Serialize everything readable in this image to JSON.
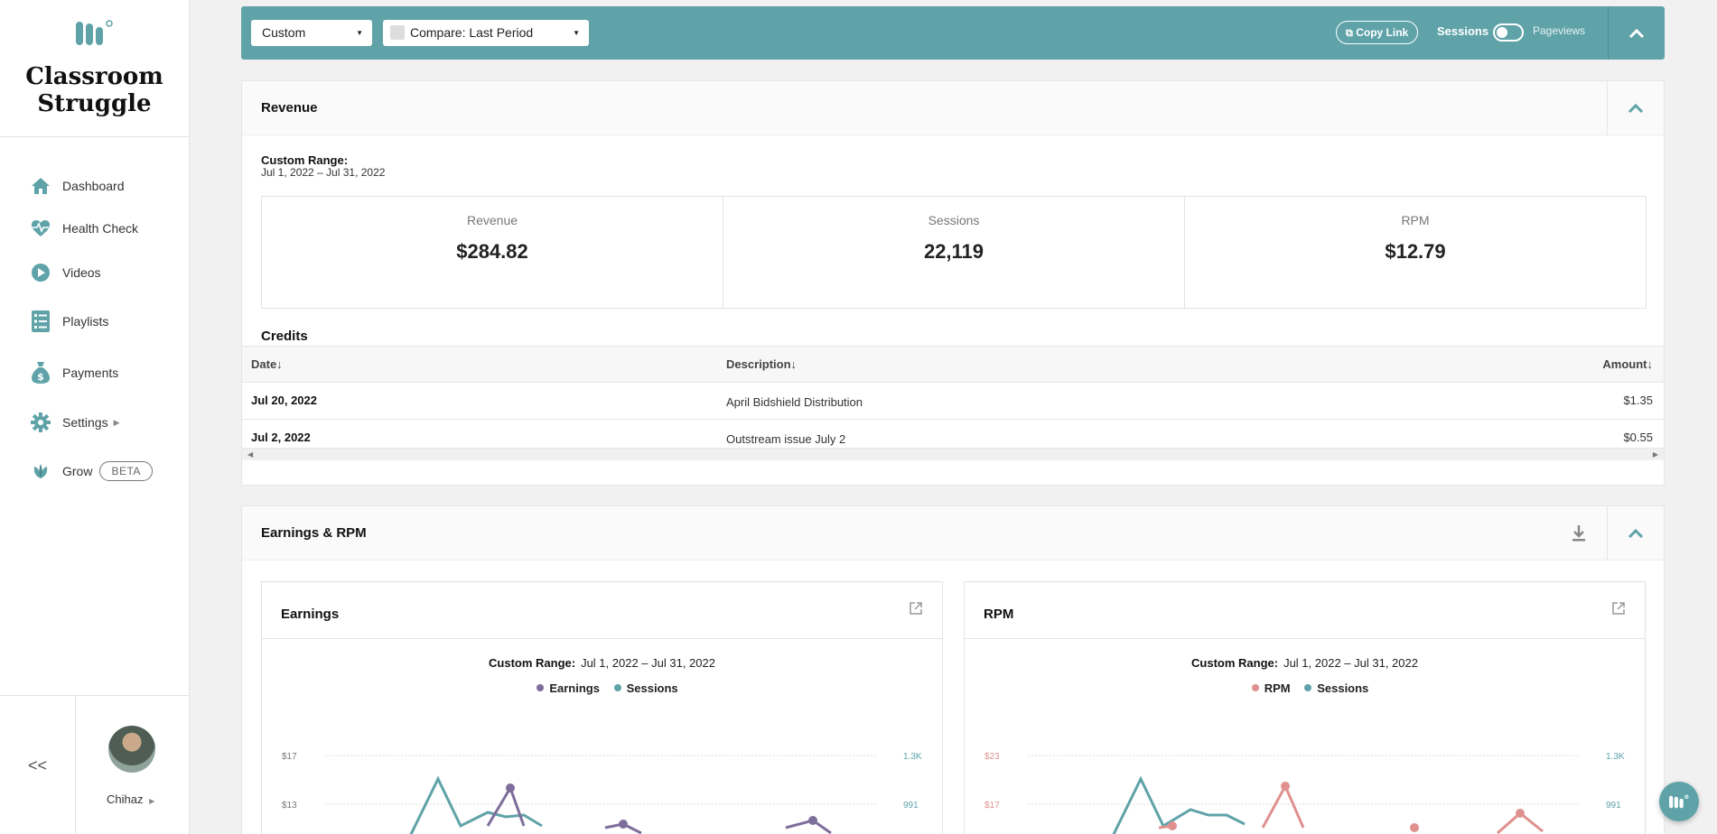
{
  "brand": {
    "name_line1": "Classroom",
    "name_line2": "Struggle"
  },
  "sidebar": {
    "items": [
      {
        "label": "Dashboard",
        "icon": "home-icon"
      },
      {
        "label": "Health Check",
        "icon": "heart-pulse-icon"
      },
      {
        "label": "Videos",
        "icon": "play-icon"
      },
      {
        "label": "Playlists",
        "icon": "playlist-icon"
      },
      {
        "label": "Payments",
        "icon": "money-bag-icon"
      },
      {
        "label": "Settings",
        "icon": "gear-icon"
      },
      {
        "label": "Grow",
        "icon": "leaf-icon",
        "badge": "BETA"
      }
    ],
    "collapse_label": "<<",
    "user_name": "Chihaz"
  },
  "toolbar": {
    "range_select": "Custom",
    "compare_select": "Compare: Last Period",
    "copy_link": "Copy Link",
    "toggle_left": "Sessions",
    "toggle_right": "Pageviews"
  },
  "revenue": {
    "title": "Revenue",
    "range_label": "Custom Range:",
    "range_value": "Jul 1, 2022 – Jul 31, 2022",
    "stats": [
      {
        "label": "Revenue",
        "value": "$284.82"
      },
      {
        "label": "Sessions",
        "value": "22,119"
      },
      {
        "label": "RPM",
        "value": "$12.79"
      }
    ]
  },
  "credits": {
    "title": "Credits",
    "columns": [
      "Date↓",
      "Description↓",
      "Amount↓"
    ],
    "rows": [
      {
        "date": "Jul 20, 2022",
        "description": "April Bidshield Distribution",
        "amount": "$1.35"
      },
      {
        "date": "Jul 2, 2022",
        "description": "Outstream issue July 2",
        "amount": "$0.55"
      }
    ]
  },
  "earnings_rpm": {
    "title": "Earnings & RPM",
    "charts": [
      {
        "title": "Earnings",
        "range_label": "Custom Range:",
        "range_value": "Jul 1, 2022 – Jul 31, 2022",
        "legend": [
          {
            "name": "Earnings",
            "color": "#7d6e9b"
          },
          {
            "name": "Sessions",
            "color": "#5fa3a9"
          }
        ],
        "left_ticks": [
          "$17",
          "$13"
        ],
        "right_ticks": [
          "1.3K",
          "991"
        ],
        "left_color": "#777777",
        "right_color": "#5fa3a9"
      },
      {
        "title": "RPM",
        "range_label": "Custom Range:",
        "range_value": "Jul 1, 2022 – Jul 31, 2022",
        "legend": [
          {
            "name": "RPM",
            "color": "#e0918e"
          },
          {
            "name": "Sessions",
            "color": "#5fa3a9"
          }
        ],
        "left_ticks": [
          "$23",
          "$17"
        ],
        "right_ticks": [
          "1.3K",
          "991"
        ],
        "left_color": "#e0918e",
        "right_color": "#5fa3a9"
      }
    ]
  },
  "colors": {
    "accent": "#5fa3a9",
    "earnings": "#7d6e9b",
    "rpm": "#e0918e"
  }
}
